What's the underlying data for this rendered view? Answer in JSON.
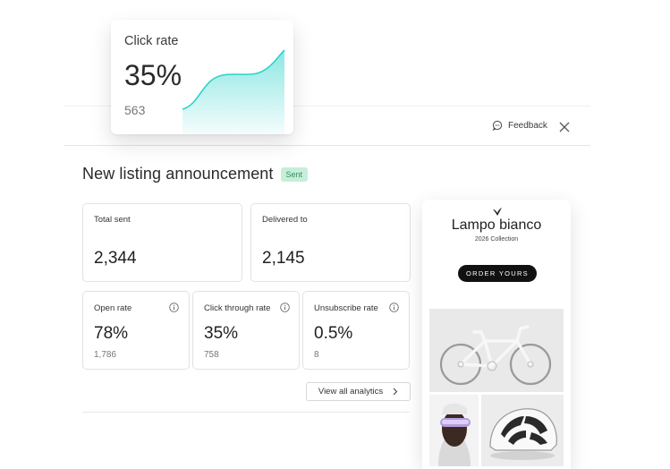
{
  "header": {
    "feedback_label": "Feedback",
    "close_icon": "close-icon",
    "feedback_icon": "chat-bubble-icon"
  },
  "campaign": {
    "title": "New listing announcement",
    "status": "Sent",
    "status_color": "#c7eed9"
  },
  "stats": {
    "total_sent": {
      "label": "Total sent",
      "value": "2,344"
    },
    "delivered_to": {
      "label": "Delivered to",
      "value": "2,145"
    },
    "open_rate": {
      "label": "Open rate",
      "value": "78%",
      "count": "1,786"
    },
    "click_through_rate": {
      "label": "Click through rate",
      "value": "35%",
      "count": "758"
    },
    "unsubscribe_rate": {
      "label": "Unsubscribe rate",
      "value": "0.5%",
      "count": "8"
    }
  },
  "analytics_button": {
    "label": "View all analytics",
    "icon": "chevron-right-icon"
  },
  "click_card": {
    "title": "Click rate",
    "value": "35%",
    "count": "563",
    "accent": "#2ed3cc"
  },
  "email_preview": {
    "brand": "Lampo bianco",
    "collection": "2026 Collection",
    "cta": "ORDER YOURS",
    "images": [
      "bicycle-image",
      "cyclist-portrait-image",
      "bike-helmet-image"
    ]
  }
}
